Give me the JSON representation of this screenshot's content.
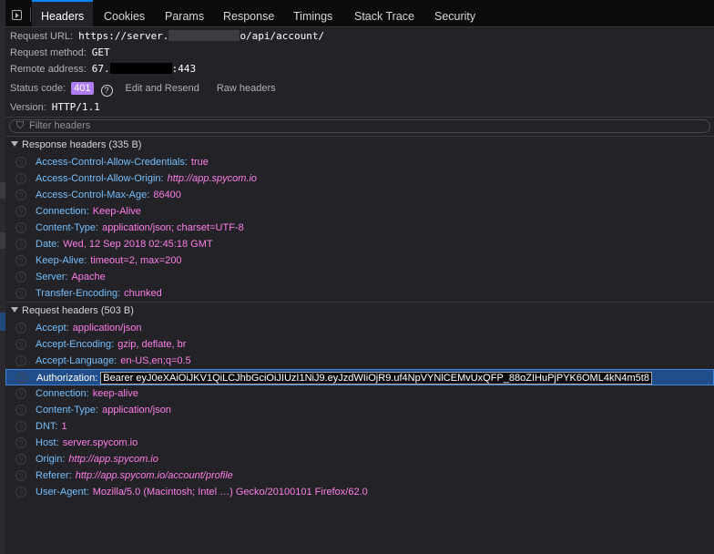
{
  "tabs": [
    {
      "label": "Headers",
      "active": true
    },
    {
      "label": "Cookies"
    },
    {
      "label": "Params"
    },
    {
      "label": "Response"
    },
    {
      "label": "Timings"
    },
    {
      "label": "Stack Trace"
    },
    {
      "label": "Security"
    }
  ],
  "summary": {
    "request_url_label": "Request URL:",
    "request_url_start": "https://server.",
    "request_url_end": "o/api/account/",
    "request_method_label": "Request method:",
    "request_method": "GET",
    "remote_address_label": "Remote address:",
    "remote_address_start": "67.",
    "remote_address_end": ":443",
    "status_code_label": "Status code:",
    "status_code": "401",
    "edit_resend": "Edit and Resend",
    "raw_headers": "Raw headers",
    "version_label": "Version:",
    "version": "HTTP/1.1"
  },
  "filter": {
    "placeholder": "Filter headers"
  },
  "response_headers": {
    "title": "Response headers (335 B)",
    "items": [
      {
        "name": "Access-Control-Allow-Credentials:",
        "value": "true"
      },
      {
        "name": "Access-Control-Allow-Origin:",
        "value": "http://app.spycom.io",
        "italic": true
      },
      {
        "name": "Access-Control-Max-Age:",
        "value": "86400"
      },
      {
        "name": "Connection:",
        "value": "Keep-Alive"
      },
      {
        "name": "Content-Type:",
        "value": "application/json; charset=UTF-8"
      },
      {
        "name": "Date:",
        "value": "Wed, 12 Sep 2018 02:45:18 GMT"
      },
      {
        "name": "Keep-Alive:",
        "value": "timeout=2, max=200"
      },
      {
        "name": "Server:",
        "value": "Apache"
      },
      {
        "name": "Transfer-Encoding:",
        "value": "chunked"
      }
    ]
  },
  "request_headers": {
    "title": "Request headers (503 B)",
    "items": [
      {
        "name": "Accept:",
        "value": "application/json"
      },
      {
        "name": "Accept-Encoding:",
        "value": "gzip, deflate, br"
      },
      {
        "name": "Accept-Language:",
        "value": "en-US,en;q=0.5"
      },
      {
        "name": "Authorization:",
        "value": "Bearer eyJ0eXAiOiJKV1QiLCJhbGciOiJIUzI1NiJ9.eyJzdWIiOjR9.uf4NpVYNlCEMvUxQFP_88oZIHuPjPYK6OML4kN4m5t8",
        "selected": true
      },
      {
        "name": "Connection:",
        "value": "keep-alive"
      },
      {
        "name": "Content-Type:",
        "value": "application/json"
      },
      {
        "name": "DNT:",
        "value": "1"
      },
      {
        "name": "Host:",
        "value": "server.spycom.io"
      },
      {
        "name": "Origin:",
        "value": "http://app.spycom.io",
        "italic": true
      },
      {
        "name": "Referer:",
        "value": "http://app.spycom.io/account/profile",
        "italic": true
      },
      {
        "name": "User-Agent:",
        "value": "Mozilla/5.0 (Macintosh; Intel …) Gecko/20100101 Firefox/62.0"
      }
    ]
  },
  "colors": {
    "background": "#232327",
    "header_name": "#75bfff",
    "header_value": "#ff7de9",
    "status_badge": "#b07cf2",
    "selected_row": "#204e8a"
  }
}
